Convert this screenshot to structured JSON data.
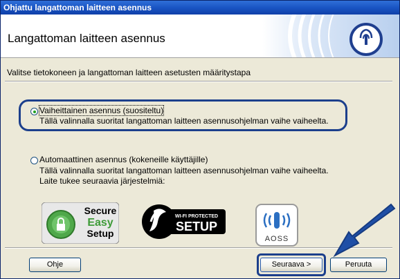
{
  "window": {
    "title": "Ohjattu langattoman laitteen asennus"
  },
  "header": {
    "title": "Langattoman laitteen asennus"
  },
  "main": {
    "instruction": "Valitse tietokoneen ja langattoman laitteen asetusten määritystapa",
    "options": [
      {
        "label": "Vaiheittainen asennus (suositeltu)",
        "description": [
          "Tällä valinnalla suoritat langattoman laitteen asennusohjelman vaihe vaiheelta."
        ],
        "selected": true
      },
      {
        "label": "Automaattinen asennus (kokeneille käyttäjille)",
        "description": [
          "Tällä valinnalla suoritat langattoman laitteen asennusohjelman vaihe vaiheelta.",
          "Laite tukee seuraavia järjestelmiä:"
        ],
        "selected": false
      }
    ],
    "badges": {
      "secure_easy_setup": [
        "Secure",
        "Easy",
        "Setup"
      ],
      "wifi_protected_setup": [
        "WI-FI PROTECTED",
        "SETUP"
      ],
      "aoss": "AOSS"
    }
  },
  "footer": {
    "help_label": "Ohje",
    "next_label": "Seuraava >",
    "cancel_label": "Peruuta"
  },
  "colors": {
    "titlebar": "#1a55c4",
    "dialog_bg": "#ece9d8",
    "annotation_blue": "#1c3f8c",
    "arrow_blue": "#1f4fa6",
    "radio_dot": "#21a121"
  },
  "icons": [
    "wireless-logo-icon",
    "padlock-icon",
    "wifi-protected-setup-icon",
    "aoss-wireless-icon",
    "pointer-arrow-icon"
  ]
}
